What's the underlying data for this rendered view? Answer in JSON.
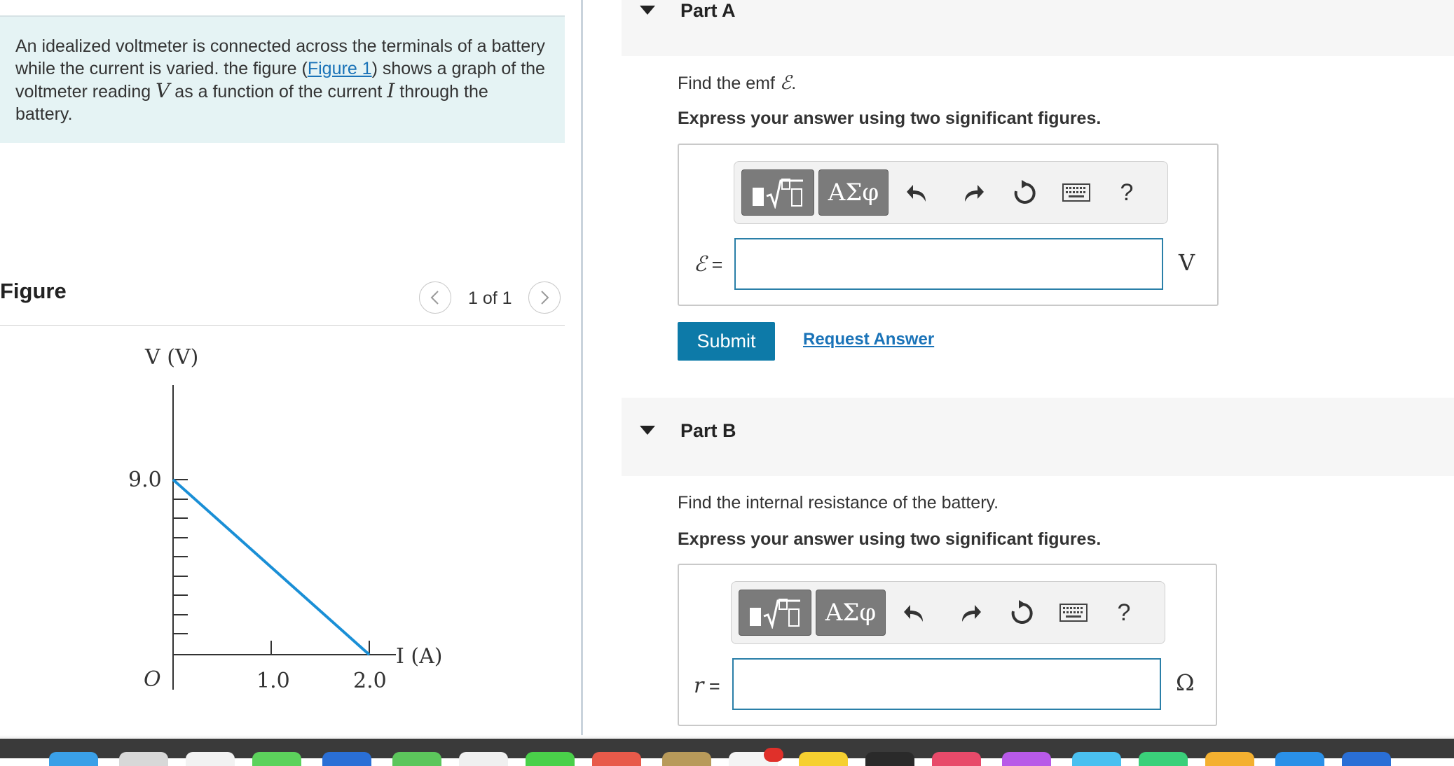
{
  "problem": {
    "text_before_link": "An idealized voltmeter is connected across the terminals of a battery while the current is varied. the figure (",
    "link_text": "Figure 1",
    "text_after_link": ") shows a graph of the voltmeter reading ",
    "var_v": "V",
    "text_mid": " as a function of the current ",
    "var_i": "I",
    "text_end": " through the battery."
  },
  "figure": {
    "title": "Figure",
    "pager": "1 of 1",
    "prev_icon": "chevron-left-icon",
    "next_icon": "chevron-right-icon"
  },
  "graph": {
    "y_axis_label": "V (V)",
    "x_axis_label": "I (A)",
    "origin_label": "O",
    "y_tick_label": "9.0",
    "x_tick_labels": [
      "1.0",
      "2.0"
    ],
    "line_color": "#1a8fd6",
    "line": [
      {
        "I": 0,
        "V": 9.0
      },
      {
        "I": 2.0,
        "V": 0
      }
    ]
  },
  "partA": {
    "title": "Part A",
    "question_prefix": "Find the emf ",
    "question_symbol": "ℰ",
    "question_suffix": ".",
    "instruction": "Express your answer using two significant figures.",
    "var_symbol": "ℰ",
    "var_eq": " =",
    "unit": "V",
    "input_value": "",
    "submit": "Submit",
    "request": "Request Answer"
  },
  "partB": {
    "title": "Part B",
    "question": "Find the internal resistance of the battery.",
    "instruction": "Express your answer using two significant figures.",
    "var_symbol": "r",
    "var_eq": " =",
    "unit": "Ω",
    "input_value": ""
  },
  "toolbar": {
    "greek_label": "ΑΣφ",
    "help_label": "?",
    "icons": [
      "templates-icon",
      "greek-letters-icon",
      "undo-icon",
      "redo-icon",
      "reset-icon",
      "keyboard-icon",
      "help-icon"
    ]
  },
  "colors": {
    "accent": "#0d7aa8",
    "problem_bg": "#e5f3f4",
    "link": "#1a73b8"
  }
}
